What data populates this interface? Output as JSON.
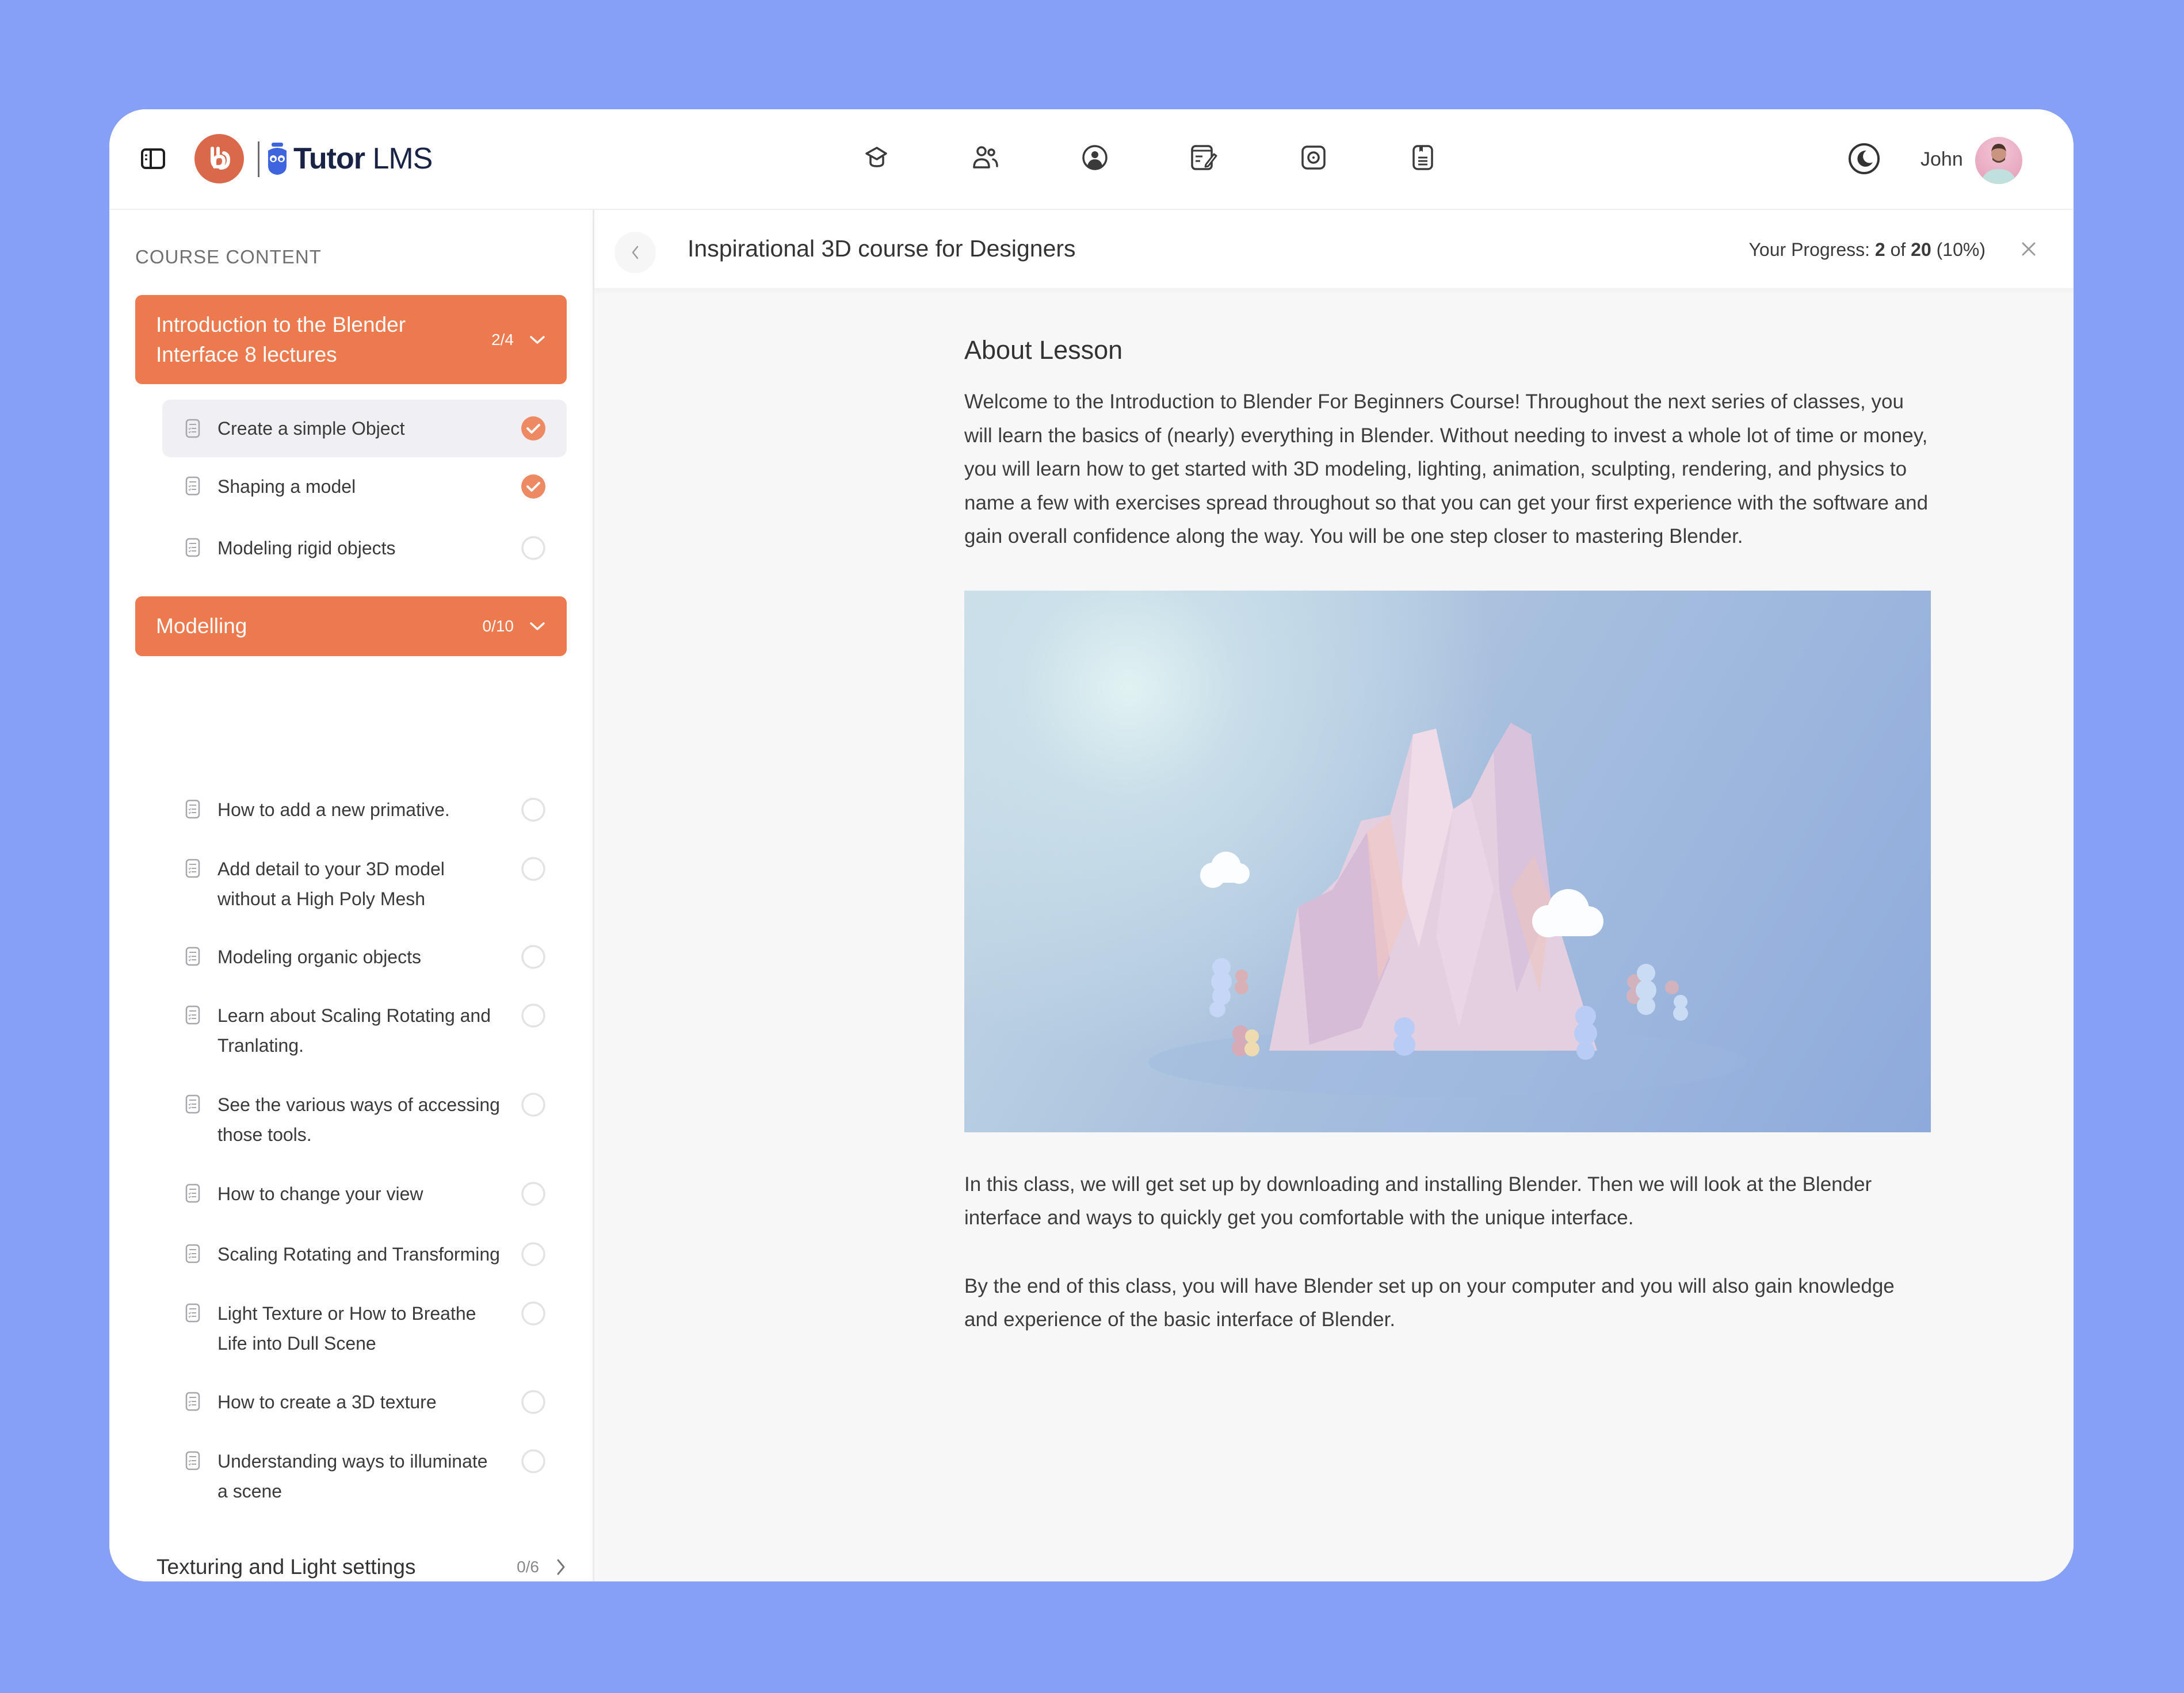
{
  "header": {
    "brand_name_bold": "Tutor",
    "brand_name_light": "LMS",
    "nav_icons": [
      "graduation-cap-icon",
      "users-icon",
      "user-circle-icon",
      "notebook-edit-icon",
      "camera-icon",
      "clipboard-icon"
    ],
    "user_name": "John"
  },
  "sidebar": {
    "section_label": "COURSE CONTENT",
    "topics": [
      {
        "title": "Introduction to the Blender Interface 8 lectures",
        "title_line1": "Introduction to the Blender",
        "title_line2": "Interface 8 lectures",
        "count": "2/4",
        "expanded": true,
        "lessons": [
          {
            "title": "Create a simple Object",
            "completed": true,
            "active": true
          },
          {
            "title": "Shaping a model",
            "completed": true
          },
          {
            "title": "Modeling rigid objects",
            "completed": false
          }
        ]
      },
      {
        "title": "Modelling",
        "count": "0/10",
        "expanded": true,
        "lessons": [
          {
            "title": "How to add a new primative.",
            "completed": false
          },
          {
            "title": "Add detail to your 3D model without a High Poly Mesh",
            "line1": "Add detail to your 3D model",
            "line2": "without a High Poly Mesh",
            "completed": false
          },
          {
            "title": "Modeling organic objects",
            "completed": false
          },
          {
            "title": "Learn about Scaling Rotating and Tranlating.",
            "line1": "Learn about Scaling Rotating and",
            "line2": "Tranlating.",
            "completed": false
          },
          {
            "title": "See the various ways of accessing those tools.",
            "line1": "See the various ways of accessing",
            "line2": "those tools.",
            "completed": false
          },
          {
            "title": "How to change your view",
            "completed": false
          },
          {
            "title": "Scaling Rotating and Transforming",
            "completed": false
          },
          {
            "title": "Light Texture or How to Breathe Life into Dull Scene",
            "line1": "Light Texture or How to Breathe",
            "line2": "Life into Dull Scene",
            "completed": false
          },
          {
            "title": "How to create a 3D texture",
            "completed": false
          },
          {
            "title": "Understanding ways to illuminate a scene",
            "line1": "Understanding ways to illuminate",
            "line2": "a scene",
            "completed": false
          }
        ]
      },
      {
        "title": "Texturing and Light settings",
        "count": "0/6",
        "expanded": false
      }
    ]
  },
  "lesson_bar": {
    "course_title": "Inspirational 3D course for Designers",
    "progress_label": "Your Progress:",
    "progress_completed": "2",
    "progress_of": "of",
    "progress_total": "20",
    "progress_percent": "(10%)"
  },
  "content": {
    "heading": "About Lesson",
    "paragraph1": "Welcome to the Introduction to Blender For Beginners Course! Throughout the next series of classes, you will learn the basics of (nearly) everything in Blender. Without needing to invest a whole lot of time or money, you will learn how to get started with 3D modeling, lighting, animation, sculpting, rendering, and physics to name a few with exercises spread throughout so that you can get your first experience with the software and gain overall confidence along the way. You will be one step closer to mastering Blender.",
    "image_description": "Low-poly pastel 3D mountain scene with clouds and trees",
    "paragraph2": "In this class, we will get set up by downloading and installing Blender. Then we will look at the Blender interface and ways to quickly get you comfortable with the unique interface.",
    "paragraph3": "By the end of this class, you will have Blender set up on your computer and you will also gain knowledge and experience of the basic interface of Blender."
  },
  "colors": {
    "page_background": "#87a0f7",
    "accent": "#ed7a4e",
    "completed_check": "#ee8a63",
    "brand_mark": "#d9694a",
    "tutor_blue": "#3e64de"
  }
}
